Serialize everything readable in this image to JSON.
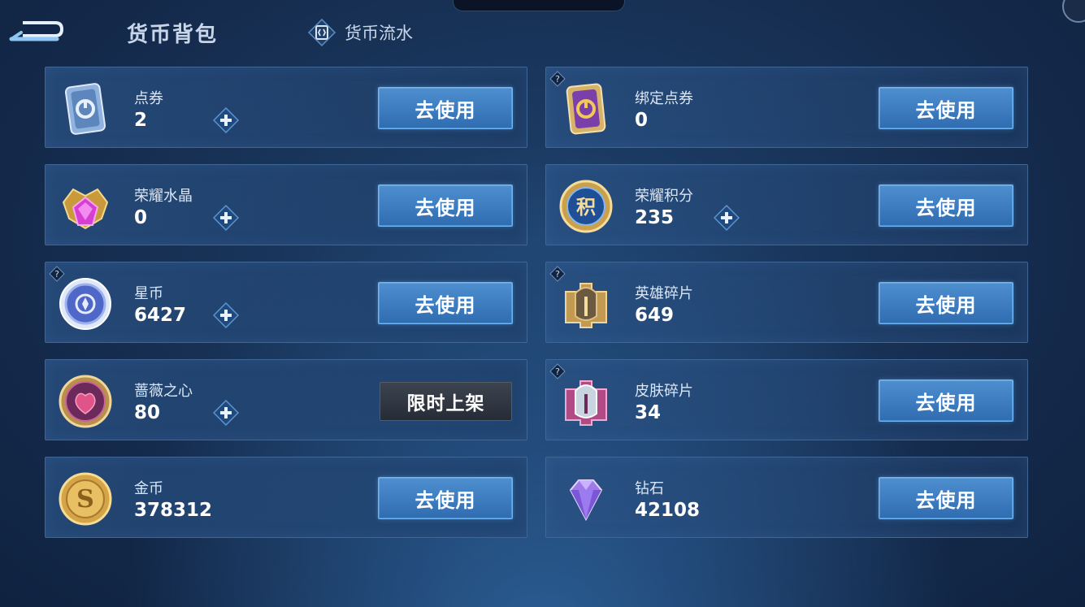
{
  "header": {
    "title": "货币背包",
    "flow_tab_label": "货币流水"
  },
  "colors": {
    "accent_button": "#3f7fc3",
    "card_border": "#3f6694",
    "background": "#15294a"
  },
  "currencies": [
    {
      "name": "点券",
      "amount": "2",
      "icon": "coupon-card-icon",
      "has_plus": true,
      "has_help": false,
      "action": "去使用"
    },
    {
      "name": "绑定点券",
      "amount": "0",
      "icon": "bound-coupon-card-icon",
      "has_plus": false,
      "has_help": true,
      "action": "去使用"
    },
    {
      "name": "荣耀水晶",
      "amount": "0",
      "icon": "glory-crystal-icon",
      "has_plus": true,
      "has_help": false,
      "action": "去使用"
    },
    {
      "name": "荣耀积分",
      "amount": "235",
      "icon": "glory-points-icon",
      "has_plus": true,
      "has_help": false,
      "action": "去使用"
    },
    {
      "name": "星币",
      "amount": "6427",
      "icon": "star-coin-icon",
      "has_plus": true,
      "has_help": true,
      "action": "去使用"
    },
    {
      "name": "英雄碎片",
      "amount": "649",
      "icon": "hero-fragment-icon",
      "has_plus": false,
      "has_help": true,
      "action": "去使用"
    },
    {
      "name": "蔷薇之心",
      "amount": "80",
      "icon": "rose-heart-icon",
      "has_plus": true,
      "has_help": false,
      "action": "限时上架"
    },
    {
      "name": "皮肤碎片",
      "amount": "34",
      "icon": "skin-fragment-icon",
      "has_plus": false,
      "has_help": true,
      "action": "去使用"
    },
    {
      "name": "金币",
      "amount": "378312",
      "icon": "gold-coin-icon",
      "has_plus": false,
      "has_help": false,
      "action": "去使用"
    },
    {
      "name": "钻石",
      "amount": "42108",
      "icon": "diamond-icon",
      "has_plus": false,
      "has_help": false,
      "action": "去使用"
    }
  ]
}
